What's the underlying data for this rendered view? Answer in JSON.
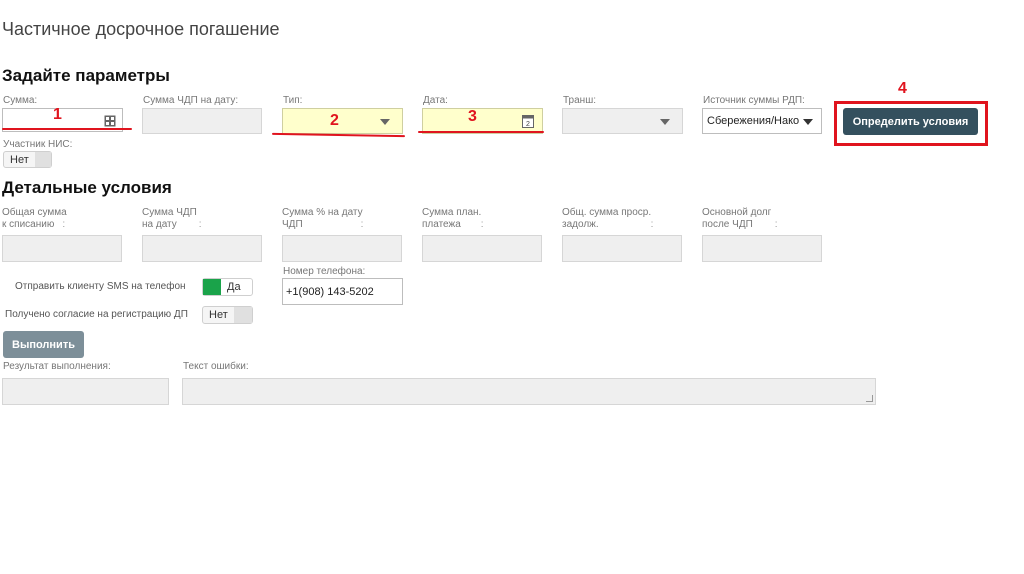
{
  "page": {
    "title": "Частичное досрочное погашение"
  },
  "params": {
    "heading": "Задайте параметры",
    "sum_label": "Сумма:",
    "sum_chdp_date_label": "Сумма ЧДП на дату:",
    "type_label": "Тип:",
    "date_label": "Дата:",
    "tranche_label": "Транш:",
    "source_label": "Источник суммы РДП:",
    "source_value": "Сбережения/Нако",
    "determine_button": "Определить условия",
    "nis_label": "Участник НИС:",
    "nis_value": "Нет",
    "icons": {
      "sum": "calculator-icon",
      "type": "chevron-down-icon",
      "date": "calendar-icon",
      "tranche": "chevron-down-icon",
      "source": "chevron-down-icon"
    }
  },
  "details": {
    "heading": "Детальные условия",
    "fields": [
      {
        "line1": "Общая сумма",
        "line2": "к списанию"
      },
      {
        "line1": "Сумма ЧДП",
        "line2": "на дату"
      },
      {
        "line1": "Сумма % на дату",
        "line2": "ЧДП"
      },
      {
        "line1": "Сумма план.",
        "line2": "платежа"
      },
      {
        "line1": "Общ. сумма проср.",
        "line2": "задолж."
      },
      {
        "line1": "Основной долг",
        "line2": "после ЧДП"
      }
    ],
    "colon": ":",
    "send_sms_label": "Отправить клиенту SMS на телефон",
    "send_sms_value": "Да",
    "consent_label": "Получено согласие на регистрацию ДП",
    "consent_value": "Нет",
    "phone_label": "Номер телефона:",
    "phone_value": "+1(908) 143-5202"
  },
  "execute": {
    "button": "Выполнить",
    "result_label": "Результат выполнения:",
    "error_label": "Текст ошибки:"
  },
  "annotations": {
    "n1": "1",
    "n2": "2",
    "n3": "3",
    "n4": "4",
    "color": "#e0141e"
  },
  "colors": {
    "primary_button": "#34505e",
    "secondary_button": "#7d8f99",
    "yellow_field": "#ffffcc",
    "toggle_on": "#1aa34a"
  }
}
